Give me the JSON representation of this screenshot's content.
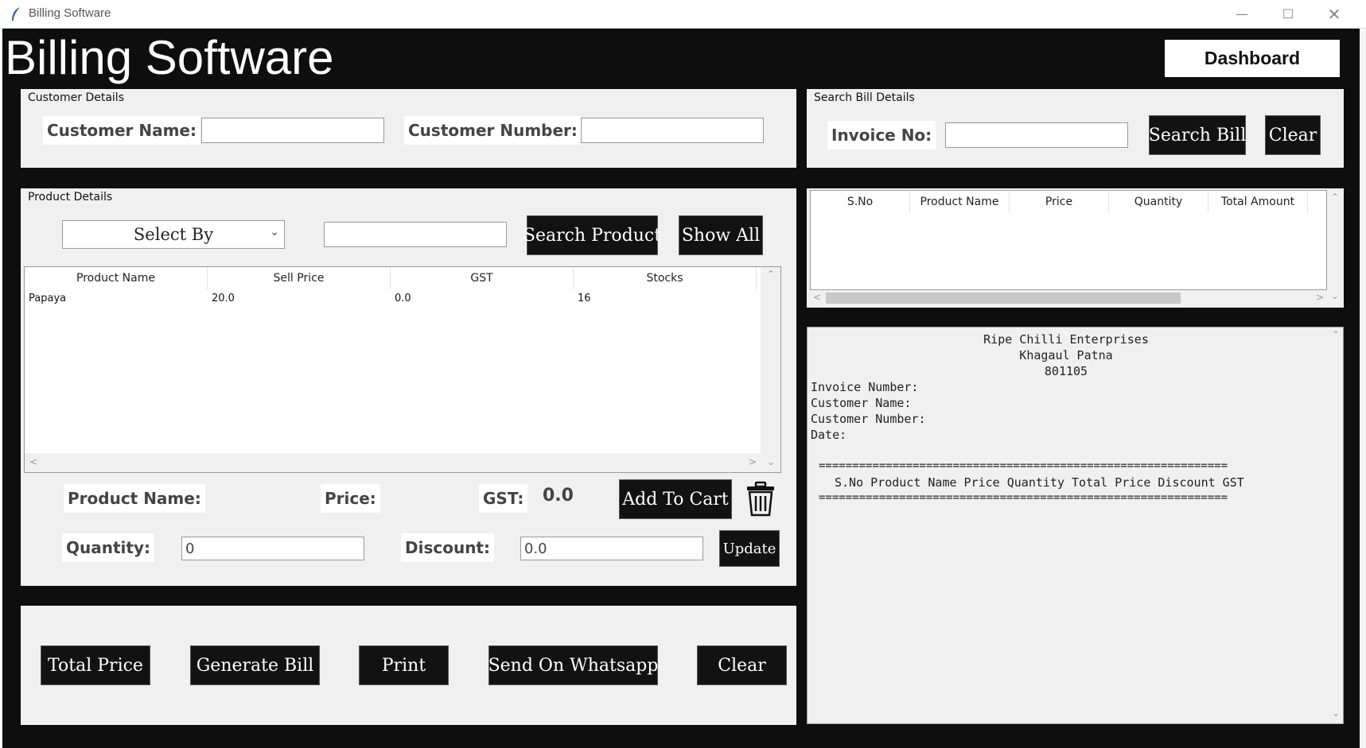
{
  "window": {
    "title": "Billing Software",
    "minimize_icon": "minimize-icon",
    "maximize_icon": "maximize-icon",
    "close_icon": "close-icon"
  },
  "header": {
    "title": "Billing Software",
    "dashboard_button": "Dashboard"
  },
  "customer": {
    "frame_label": "Customer Details",
    "name_label": "Customer Name:",
    "name_value": "",
    "number_label": "Customer Number:",
    "number_value": ""
  },
  "search_bill": {
    "frame_label": "Search Bill Details",
    "invoice_label": "Invoice No:",
    "invoice_value": "",
    "search_button": "Search Bill",
    "clear_button": "Clear"
  },
  "product": {
    "frame_label": "Product Details",
    "select_by": "Select By",
    "search_value": "",
    "search_button": "Search Product",
    "show_all_button": "Show All",
    "table": {
      "columns": [
        "Product Name",
        "Sell Price",
        "GST",
        "Stocks"
      ],
      "rows": [
        [
          "Papaya",
          "20.0",
          "0.0",
          "16"
        ]
      ]
    },
    "name_label": "Product Name:",
    "price_label": "Price:",
    "gst_label": "GST:",
    "gst_value": "0.0",
    "add_to_cart_button": "Add To Cart",
    "delete_icon": "trash-icon",
    "quantity_label": "Quantity:",
    "quantity_value": "0",
    "discount_label": "Discount:",
    "discount_value": "0.0",
    "update_button": "Update"
  },
  "cart": {
    "columns": [
      "S.No",
      "Product Name",
      "Price",
      "Quantity",
      "Total Amount"
    ]
  },
  "bill": {
    "line1": "Ripe Chilli Enterprises",
    "line2": "Khagaul Patna",
    "line3": "801105",
    "invoice_number": "Invoice Number:",
    "customer_name": "Customer Name:",
    "customer_number": "Customer Number:",
    "date": "Date:",
    "separator": "=============================================================",
    "header_row": "S.No Product Name Price Quantity Total Price Discount GST"
  },
  "actions": {
    "total_price": "Total Price",
    "generate_bill": "Generate Bill",
    "print": "Print",
    "send_whatsapp": "Send On Whatsapp",
    "clear": "Clear"
  }
}
